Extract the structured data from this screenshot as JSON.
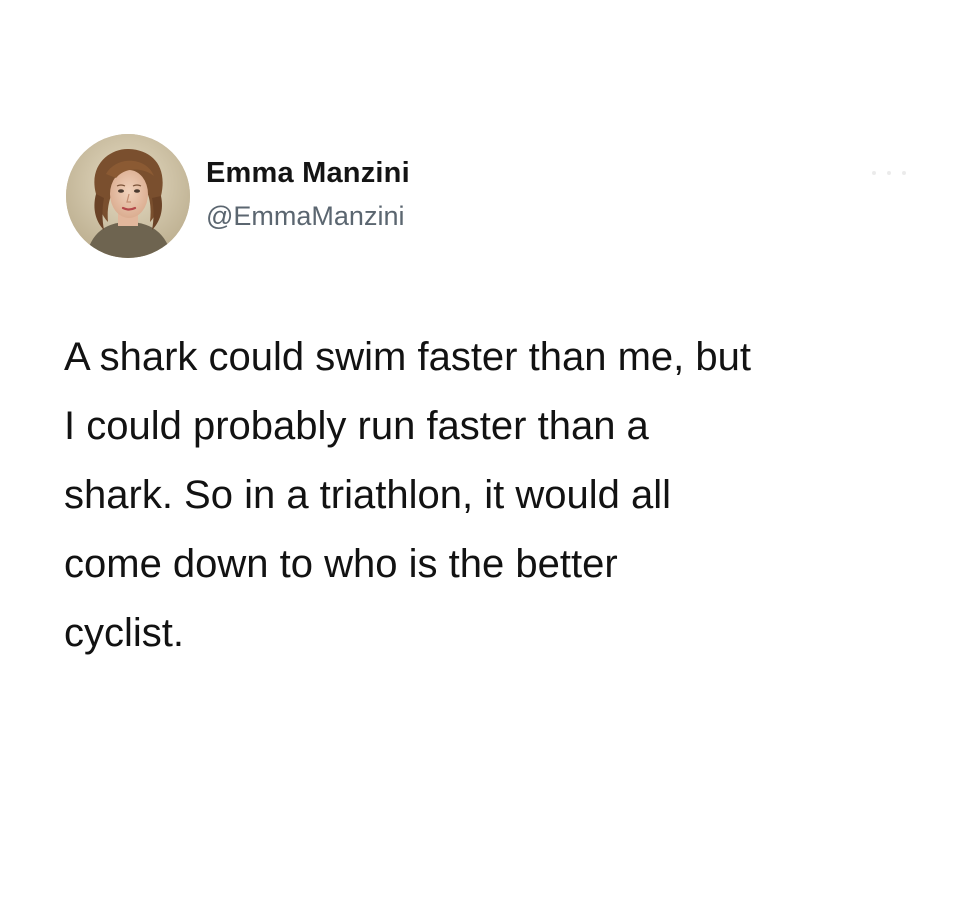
{
  "author": {
    "display_name": "Emma Manzini",
    "handle": "@EmmaManzini",
    "avatar_icon": "portrait-avatar"
  },
  "tweet": {
    "lines": [
      "A shark could swim faster than me, but",
      "I could probably run faster than a",
      "shark. So in a triathlon, it would all",
      "come down to who is the better",
      "cyclist."
    ]
  },
  "menu_icon": "more-options-icon"
}
